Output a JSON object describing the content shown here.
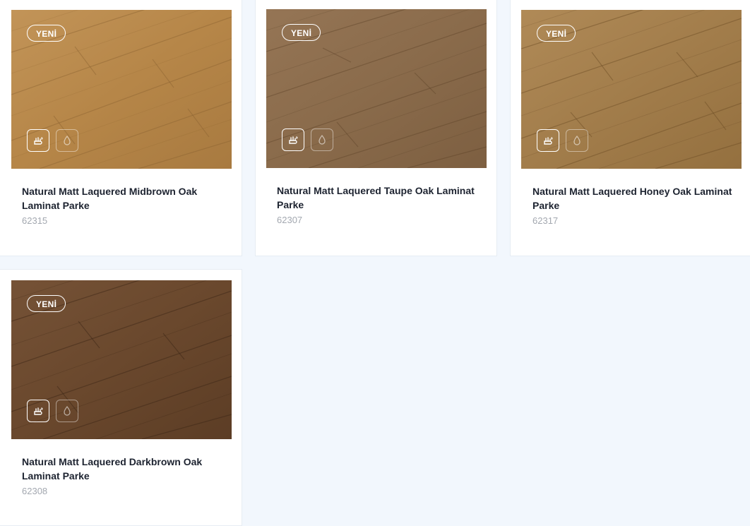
{
  "products": [
    {
      "badge": "YENİ",
      "title": "Natural Matt Laquered Midbrown Oak Laminat Parke",
      "code": "62315",
      "icons": [
        "hand-wipe-icon",
        "water-drop-icon"
      ],
      "wood_color": "#b98a52"
    },
    {
      "badge": "YENİ",
      "title": "Natural Matt Laquered Taupe Oak Laminat Parke",
      "code": "62307",
      "icons": [
        "hand-wipe-icon",
        "water-drop-icon"
      ],
      "wood_color": "#8e6e4e"
    },
    {
      "badge": "YENİ",
      "title": "Natural Matt Laquered Honey Oak Laminat Parke",
      "code": "62317",
      "icons": [
        "hand-wipe-icon",
        "water-drop-icon"
      ],
      "wood_color": "#a5804e"
    },
    {
      "badge": "YENİ",
      "title": "Natural Matt Laquered Darkbrown Oak Laminat Parke",
      "code": "62308",
      "icons": [
        "hand-wipe-icon",
        "water-drop-icon"
      ],
      "wood_color": "#6d4b30"
    }
  ],
  "colors": {
    "page_bg": "#f2f7fd",
    "card_bg": "#ffffff",
    "title": "#1d2330",
    "code": "#a3a8b0"
  }
}
